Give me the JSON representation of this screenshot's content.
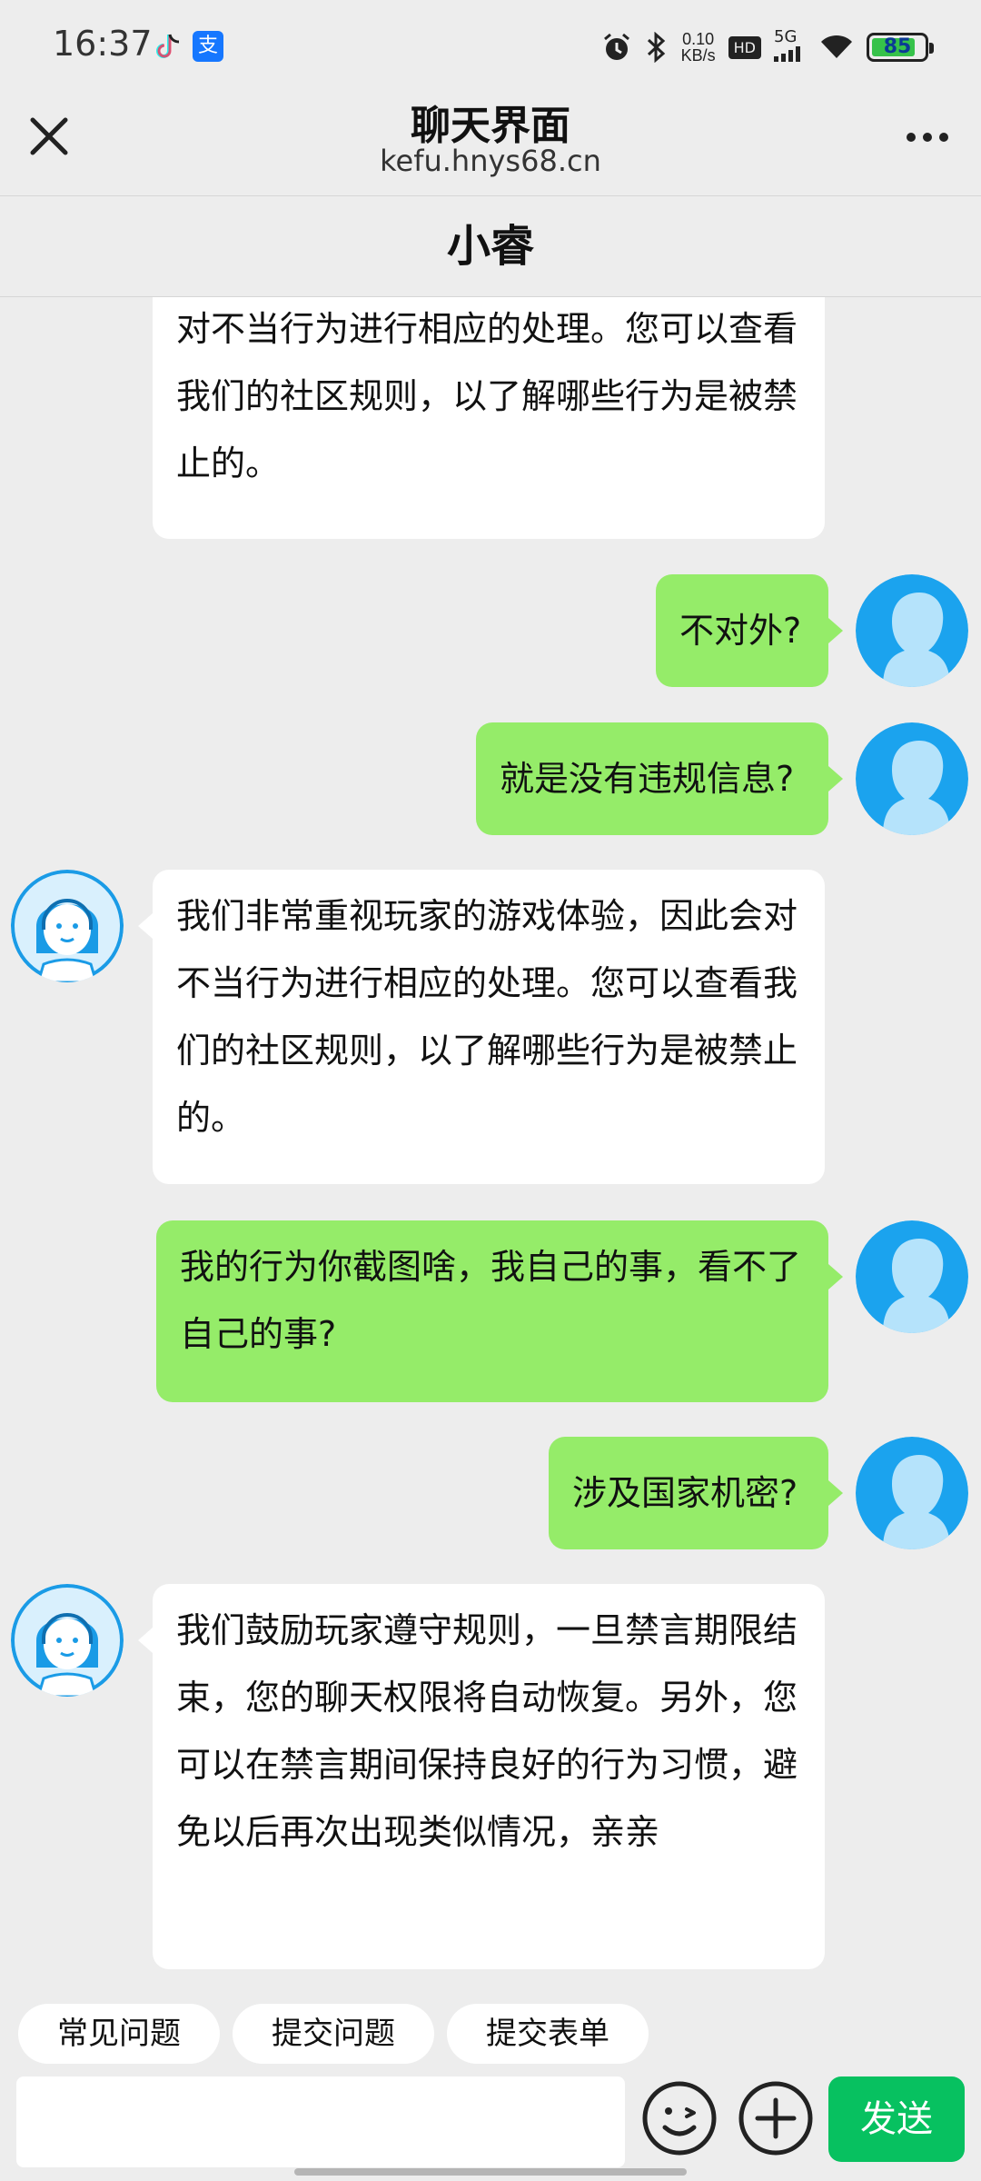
{
  "status_bar": {
    "time": "16:37",
    "net_speed_value": "0.10",
    "net_speed_unit": "KB/s",
    "hd": "HD",
    "signal": "5G",
    "battery": "85",
    "icons": [
      "tiktok-icon",
      "alipay-icon",
      "alarm-icon",
      "bluetooth-icon",
      "signal-icon",
      "wifi-icon",
      "battery-icon"
    ]
  },
  "titlebar": {
    "title": "聊天界面",
    "subtitle": "kefu.hnys68.cn"
  },
  "agent": {
    "name": "小睿"
  },
  "messages": [
    {
      "from": "agent",
      "text": "对不当行为进行相应的处理。您可以查看我们的社区规则，以了解哪些行为是被禁止的。"
    },
    {
      "from": "user",
      "text": "不对外?"
    },
    {
      "from": "user",
      "text": "就是没有违规信息?"
    },
    {
      "from": "agent",
      "text": "我们非常重视玩家的游戏体验，因此会对不当行为进行相应的处理。您可以查看我们的社区规则，以了解哪些行为是被禁止的。"
    },
    {
      "from": "user",
      "text": "我的行为你截图啥，我自己的事，看不了自己的事?"
    },
    {
      "from": "user",
      "text": "涉及国家机密?"
    },
    {
      "from": "agent",
      "text": "我们鼓励玩家遵守规则，一旦禁言期限结束，您的聊天权限将自动恢复。另外，您可以在禁言期间保持良好的行为习惯，避免以后再次出现类似情况，亲亲"
    }
  ],
  "quick_actions": [
    "常见问题",
    "提交问题",
    "提交表单"
  ],
  "composer": {
    "send_label": "发送",
    "placeholder": ""
  },
  "colors": {
    "user_bubble": "#95ec69",
    "agent_bubble": "#ffffff",
    "send_button": "#07c160",
    "background": "#ededed"
  }
}
